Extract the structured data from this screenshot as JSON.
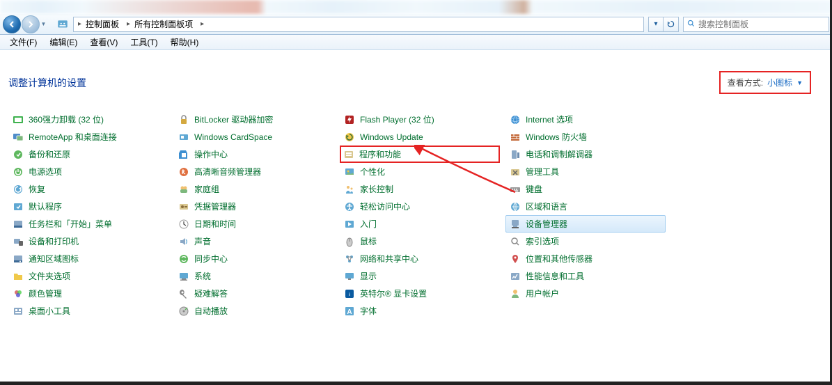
{
  "breadcrumb": {
    "seg1": "控制面板",
    "seg2": "所有控制面板项"
  },
  "search": {
    "placeholder": "搜索控制面板"
  },
  "menu": {
    "file": "文件(F)",
    "edit": "编辑(E)",
    "view": "查看(V)",
    "tools": "工具(T)",
    "help": "帮助(H)"
  },
  "header": {
    "title": "调整计算机的设置",
    "view_label": "查看方式:",
    "view_value": "小图标"
  },
  "items": [
    {
      "label": "360强力卸载 (32 位)",
      "ic": "app-360"
    },
    {
      "label": "BitLocker 驱动器加密",
      "ic": "bitlocker"
    },
    {
      "label": "Flash Player (32 位)",
      "ic": "flash"
    },
    {
      "label": "Internet 选项",
      "ic": "internet"
    },
    {
      "label": "RemoteApp 和桌面连接",
      "ic": "remoteapp"
    },
    {
      "label": "Windows CardSpace",
      "ic": "cardspace"
    },
    {
      "label": "Windows Update",
      "ic": "winupdate"
    },
    {
      "label": "Windows 防火墙",
      "ic": "firewall"
    },
    {
      "label": "备份和还原",
      "ic": "backup"
    },
    {
      "label": "操作中心",
      "ic": "actioncenter"
    },
    {
      "label": "程序和功能",
      "ic": "programs",
      "hi": true
    },
    {
      "label": "电话和调制解调器",
      "ic": "phone"
    },
    {
      "label": "电源选项",
      "ic": "power"
    },
    {
      "label": "高清晰音频管理器",
      "ic": "realtek"
    },
    {
      "label": "个性化",
      "ic": "personalize"
    },
    {
      "label": "管理工具",
      "ic": "admintools"
    },
    {
      "label": "恢复",
      "ic": "recovery"
    },
    {
      "label": "家庭组",
      "ic": "homegroup"
    },
    {
      "label": "家长控制",
      "ic": "parental"
    },
    {
      "label": "键盘",
      "ic": "keyboard"
    },
    {
      "label": "默认程序",
      "ic": "default"
    },
    {
      "label": "凭据管理器",
      "ic": "credentials"
    },
    {
      "label": "轻松访问中心",
      "ic": "easeofaccess"
    },
    {
      "label": "区域和语言",
      "ic": "region"
    },
    {
      "label": "任务栏和「开始」菜单",
      "ic": "taskbar"
    },
    {
      "label": "日期和时间",
      "ic": "datetime"
    },
    {
      "label": "入门",
      "ic": "getstarted"
    },
    {
      "label": "设备管理器",
      "ic": "devmgr",
      "sel": true
    },
    {
      "label": "设备和打印机",
      "ic": "devices"
    },
    {
      "label": "声音",
      "ic": "sound"
    },
    {
      "label": "鼠标",
      "ic": "mouse"
    },
    {
      "label": "索引选项",
      "ic": "indexing"
    },
    {
      "label": "通知区域图标",
      "ic": "notification"
    },
    {
      "label": "同步中心",
      "ic": "sync"
    },
    {
      "label": "网络和共享中心",
      "ic": "network"
    },
    {
      "label": "位置和其他传感器",
      "ic": "location"
    },
    {
      "label": "文件夹选项",
      "ic": "folderopt"
    },
    {
      "label": "系统",
      "ic": "system"
    },
    {
      "label": "显示",
      "ic": "display"
    },
    {
      "label": "性能信息和工具",
      "ic": "perf"
    },
    {
      "label": "颜色管理",
      "ic": "color"
    },
    {
      "label": "疑难解答",
      "ic": "troubleshoot"
    },
    {
      "label": "英特尔® 显卡设置",
      "ic": "intel"
    },
    {
      "label": "用户帐户",
      "ic": "users"
    },
    {
      "label": "桌面小工具",
      "ic": "gadgets"
    },
    {
      "label": "自动播放",
      "ic": "autoplay"
    },
    {
      "label": "字体",
      "ic": "fonts"
    }
  ]
}
